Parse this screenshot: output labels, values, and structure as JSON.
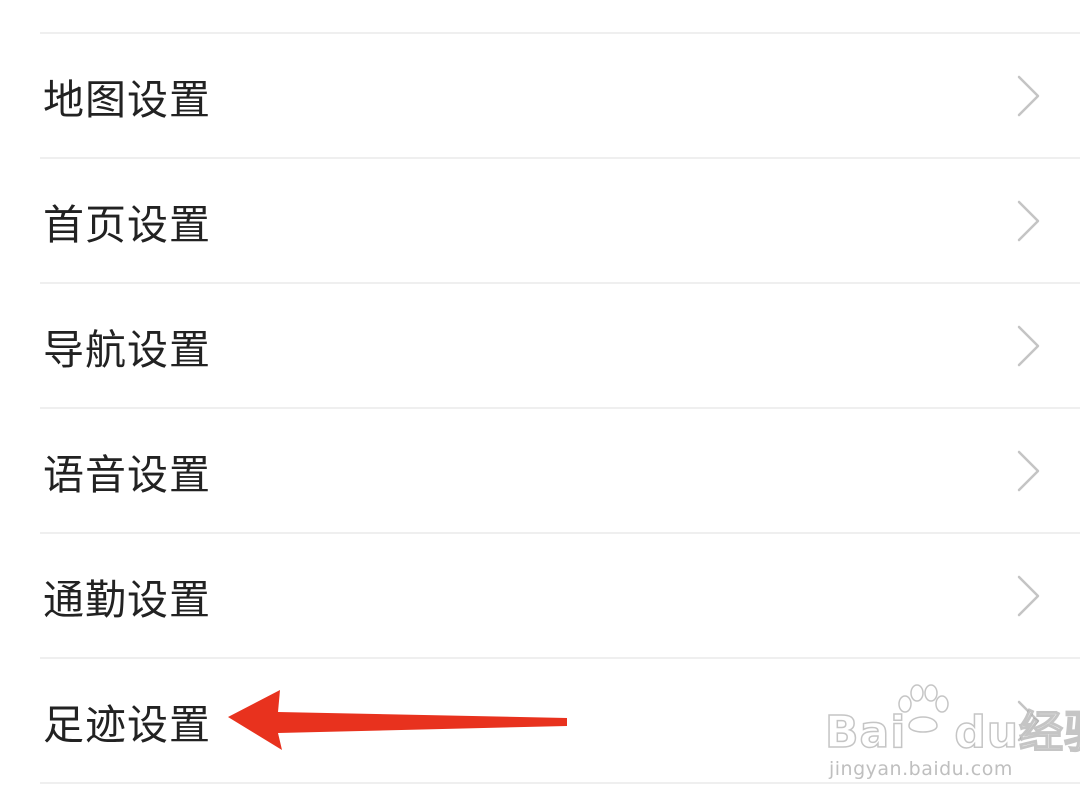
{
  "settings": {
    "items": [
      {
        "label": "地图设置"
      },
      {
        "label": "首页设置"
      },
      {
        "label": "导航设置"
      },
      {
        "label": "语音设置"
      },
      {
        "label": "通勤设置"
      },
      {
        "label": "足迹设置"
      }
    ]
  },
  "annotation": {
    "arrow_color": "#e8321e",
    "points_to": "足迹设置"
  },
  "watermark": {
    "brand_latin": "Bai",
    "brand_mark": "du",
    "brand_cn": "经验",
    "url": "jingyan.baidu.com"
  },
  "colors": {
    "background": "#ffffff",
    "text": "#222222",
    "divider": "#efefef",
    "chevron": "#c4c4c4"
  }
}
